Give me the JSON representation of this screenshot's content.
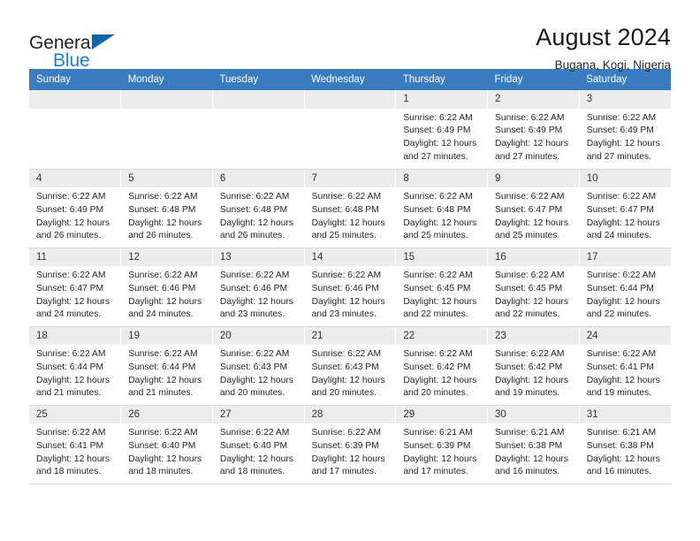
{
  "brand": {
    "word_one": "General",
    "word_two": "Blue",
    "flag_icon": "triangle-flag-icon"
  },
  "header": {
    "title": "August 2024",
    "subtitle": "Bugana, Kogi, Nigeria"
  },
  "calendar": {
    "weekday_headers": [
      "Sunday",
      "Monday",
      "Tuesday",
      "Wednesday",
      "Thursday",
      "Friday",
      "Saturday"
    ],
    "labels": {
      "sunrise_prefix": "Sunrise:",
      "sunset_prefix": "Sunset:",
      "daylight_prefix": "Daylight:"
    },
    "weeks": [
      [
        {
          "day": "",
          "empty": true
        },
        {
          "day": "",
          "empty": true
        },
        {
          "day": "",
          "empty": true
        },
        {
          "day": "",
          "empty": true
        },
        {
          "day": "1",
          "sunrise": "Sunrise: 6:22 AM",
          "sunset": "Sunset: 6:49 PM",
          "daylight_line1": "Daylight: 12 hours",
          "daylight_line2": "and 27 minutes."
        },
        {
          "day": "2",
          "sunrise": "Sunrise: 6:22 AM",
          "sunset": "Sunset: 6:49 PM",
          "daylight_line1": "Daylight: 12 hours",
          "daylight_line2": "and 27 minutes."
        },
        {
          "day": "3",
          "sunrise": "Sunrise: 6:22 AM",
          "sunset": "Sunset: 6:49 PM",
          "daylight_line1": "Daylight: 12 hours",
          "daylight_line2": "and 27 minutes."
        }
      ],
      [
        {
          "day": "4",
          "sunrise": "Sunrise: 6:22 AM",
          "sunset": "Sunset: 6:49 PM",
          "daylight_line1": "Daylight: 12 hours",
          "daylight_line2": "and 26 minutes."
        },
        {
          "day": "5",
          "sunrise": "Sunrise: 6:22 AM",
          "sunset": "Sunset: 6:48 PM",
          "daylight_line1": "Daylight: 12 hours",
          "daylight_line2": "and 26 minutes."
        },
        {
          "day": "6",
          "sunrise": "Sunrise: 6:22 AM",
          "sunset": "Sunset: 6:48 PM",
          "daylight_line1": "Daylight: 12 hours",
          "daylight_line2": "and 26 minutes."
        },
        {
          "day": "7",
          "sunrise": "Sunrise: 6:22 AM",
          "sunset": "Sunset: 6:48 PM",
          "daylight_line1": "Daylight: 12 hours",
          "daylight_line2": "and 25 minutes."
        },
        {
          "day": "8",
          "sunrise": "Sunrise: 6:22 AM",
          "sunset": "Sunset: 6:48 PM",
          "daylight_line1": "Daylight: 12 hours",
          "daylight_line2": "and 25 minutes."
        },
        {
          "day": "9",
          "sunrise": "Sunrise: 6:22 AM",
          "sunset": "Sunset: 6:47 PM",
          "daylight_line1": "Daylight: 12 hours",
          "daylight_line2": "and 25 minutes."
        },
        {
          "day": "10",
          "sunrise": "Sunrise: 6:22 AM",
          "sunset": "Sunset: 6:47 PM",
          "daylight_line1": "Daylight: 12 hours",
          "daylight_line2": "and 24 minutes."
        }
      ],
      [
        {
          "day": "11",
          "sunrise": "Sunrise: 6:22 AM",
          "sunset": "Sunset: 6:47 PM",
          "daylight_line1": "Daylight: 12 hours",
          "daylight_line2": "and 24 minutes."
        },
        {
          "day": "12",
          "sunrise": "Sunrise: 6:22 AM",
          "sunset": "Sunset: 6:46 PM",
          "daylight_line1": "Daylight: 12 hours",
          "daylight_line2": "and 24 minutes."
        },
        {
          "day": "13",
          "sunrise": "Sunrise: 6:22 AM",
          "sunset": "Sunset: 6:46 PM",
          "daylight_line1": "Daylight: 12 hours",
          "daylight_line2": "and 23 minutes."
        },
        {
          "day": "14",
          "sunrise": "Sunrise: 6:22 AM",
          "sunset": "Sunset: 6:46 PM",
          "daylight_line1": "Daylight: 12 hours",
          "daylight_line2": "and 23 minutes."
        },
        {
          "day": "15",
          "sunrise": "Sunrise: 6:22 AM",
          "sunset": "Sunset: 6:45 PM",
          "daylight_line1": "Daylight: 12 hours",
          "daylight_line2": "and 22 minutes."
        },
        {
          "day": "16",
          "sunrise": "Sunrise: 6:22 AM",
          "sunset": "Sunset: 6:45 PM",
          "daylight_line1": "Daylight: 12 hours",
          "daylight_line2": "and 22 minutes."
        },
        {
          "day": "17",
          "sunrise": "Sunrise: 6:22 AM",
          "sunset": "Sunset: 6:44 PM",
          "daylight_line1": "Daylight: 12 hours",
          "daylight_line2": "and 22 minutes."
        }
      ],
      [
        {
          "day": "18",
          "sunrise": "Sunrise: 6:22 AM",
          "sunset": "Sunset: 6:44 PM",
          "daylight_line1": "Daylight: 12 hours",
          "daylight_line2": "and 21 minutes."
        },
        {
          "day": "19",
          "sunrise": "Sunrise: 6:22 AM",
          "sunset": "Sunset: 6:44 PM",
          "daylight_line1": "Daylight: 12 hours",
          "daylight_line2": "and 21 minutes."
        },
        {
          "day": "20",
          "sunrise": "Sunrise: 6:22 AM",
          "sunset": "Sunset: 6:43 PM",
          "daylight_line1": "Daylight: 12 hours",
          "daylight_line2": "and 20 minutes."
        },
        {
          "day": "21",
          "sunrise": "Sunrise: 6:22 AM",
          "sunset": "Sunset: 6:43 PM",
          "daylight_line1": "Daylight: 12 hours",
          "daylight_line2": "and 20 minutes."
        },
        {
          "day": "22",
          "sunrise": "Sunrise: 6:22 AM",
          "sunset": "Sunset: 6:42 PM",
          "daylight_line1": "Daylight: 12 hours",
          "daylight_line2": "and 20 minutes."
        },
        {
          "day": "23",
          "sunrise": "Sunrise: 6:22 AM",
          "sunset": "Sunset: 6:42 PM",
          "daylight_line1": "Daylight: 12 hours",
          "daylight_line2": "and 19 minutes."
        },
        {
          "day": "24",
          "sunrise": "Sunrise: 6:22 AM",
          "sunset": "Sunset: 6:41 PM",
          "daylight_line1": "Daylight: 12 hours",
          "daylight_line2": "and 19 minutes."
        }
      ],
      [
        {
          "day": "25",
          "sunrise": "Sunrise: 6:22 AM",
          "sunset": "Sunset: 6:41 PM",
          "daylight_line1": "Daylight: 12 hours",
          "daylight_line2": "and 18 minutes."
        },
        {
          "day": "26",
          "sunrise": "Sunrise: 6:22 AM",
          "sunset": "Sunset: 6:40 PM",
          "daylight_line1": "Daylight: 12 hours",
          "daylight_line2": "and 18 minutes."
        },
        {
          "day": "27",
          "sunrise": "Sunrise: 6:22 AM",
          "sunset": "Sunset: 6:40 PM",
          "daylight_line1": "Daylight: 12 hours",
          "daylight_line2": "and 18 minutes."
        },
        {
          "day": "28",
          "sunrise": "Sunrise: 6:22 AM",
          "sunset": "Sunset: 6:39 PM",
          "daylight_line1": "Daylight: 12 hours",
          "daylight_line2": "and 17 minutes."
        },
        {
          "day": "29",
          "sunrise": "Sunrise: 6:21 AM",
          "sunset": "Sunset: 6:39 PM",
          "daylight_line1": "Daylight: 12 hours",
          "daylight_line2": "and 17 minutes."
        },
        {
          "day": "30",
          "sunrise": "Sunrise: 6:21 AM",
          "sunset": "Sunset: 6:38 PM",
          "daylight_line1": "Daylight: 12 hours",
          "daylight_line2": "and 16 minutes."
        },
        {
          "day": "31",
          "sunrise": "Sunrise: 6:21 AM",
          "sunset": "Sunset: 6:38 PM",
          "daylight_line1": "Daylight: 12 hours",
          "daylight_line2": "and 16 minutes."
        }
      ]
    ]
  },
  "colors": {
    "header_blue": "#3a7cc0",
    "brand_blue": "#1b7fd4",
    "daynum_band": "#ededed",
    "cell_border": "#d8d8d8"
  }
}
